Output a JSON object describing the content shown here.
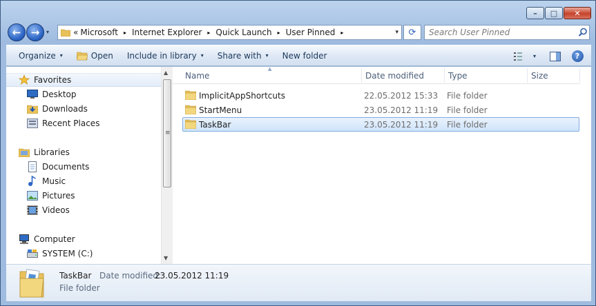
{
  "window": {
    "caption": {
      "minimize": "–",
      "maximize": "□",
      "close": "✕"
    }
  },
  "nav": {
    "back_glyph": "←",
    "forward_glyph": "→",
    "history_glyph": "▾",
    "refresh_glyph": "⟳",
    "breadcrumb_lead": "«",
    "breadcrumbs": [
      "Microsoft",
      "Internet Explorer",
      "Quick Launch",
      "User Pinned"
    ],
    "separator_glyph": "▸",
    "address_dropdown_glyph": "▾",
    "search_placeholder": "Search User Pinned"
  },
  "toolbar": {
    "organize": "Organize",
    "open": "Open",
    "include_in_library": "Include in library",
    "share_with": "Share with",
    "new_folder": "New folder",
    "dropdown_glyph": "▾",
    "help_glyph": "?"
  },
  "navpane": {
    "favorites": {
      "header": "Favorites",
      "items": [
        "Desktop",
        "Downloads",
        "Recent Places"
      ]
    },
    "libraries": {
      "header": "Libraries",
      "items": [
        "Documents",
        "Music",
        "Pictures",
        "Videos"
      ]
    },
    "computer": {
      "header": "Computer",
      "items": [
        "SYSTEM (C:)"
      ]
    },
    "scroll": {
      "up": "▲",
      "down": "▼",
      "grip": "≡"
    }
  },
  "files": {
    "columns": {
      "name": "Name",
      "date": "Date modified",
      "type": "Type",
      "size": "Size"
    },
    "sort_glyph": "▲",
    "rows": [
      {
        "name": "ImplicitAppShortcuts",
        "date": "22.05.2012 15:33",
        "type": "File folder"
      },
      {
        "name": "StartMenu",
        "date": "23.05.2012 11:19",
        "type": "File folder"
      },
      {
        "name": "TaskBar",
        "date": "23.05.2012 11:19",
        "type": "File folder"
      }
    ]
  },
  "details": {
    "name": "TaskBar",
    "date_label": "Date modified:",
    "date_value": "23.05.2012 11:19",
    "type": "File folder"
  },
  "colors": {
    "accent": "#2a63c4",
    "folder": "#e8c15a",
    "selection": "#cfe4fb"
  }
}
